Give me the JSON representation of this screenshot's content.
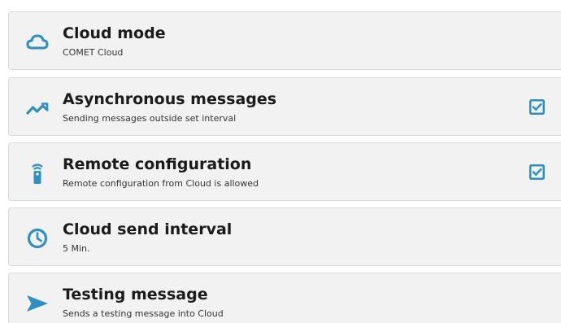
{
  "colors": {
    "accent": "#2f8fc0",
    "card_background": "#f2f2f2",
    "card_border": "#d9d9d9"
  },
  "settings": {
    "items": [
      {
        "title": "Cloud mode",
        "subtitle": "COMET Cloud",
        "icon": "cloud-icon"
      },
      {
        "title": "Asynchronous messages",
        "subtitle": "Sending messages outside set interval",
        "icon": "wave-icon",
        "checked": true
      },
      {
        "title": "Remote configuration",
        "subtitle": "Remote configuration from Cloud is allowed",
        "icon": "remote-icon",
        "checked": true
      },
      {
        "title": "Cloud send interval",
        "subtitle": "5 Min.",
        "icon": "clock-icon"
      },
      {
        "title": "Testing message",
        "subtitle": "Sends a testing message into Cloud",
        "icon": "send-icon"
      }
    ]
  }
}
